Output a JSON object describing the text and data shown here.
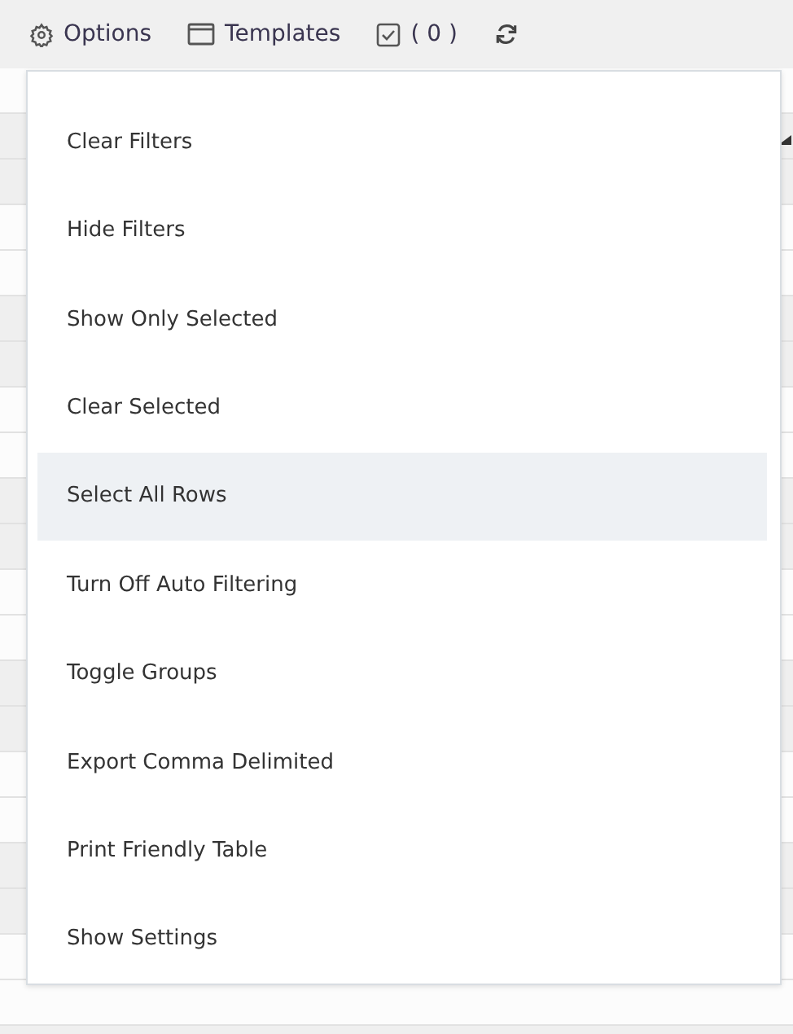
{
  "toolbar": [
    {
      "kind": "gear",
      "label": "Options"
    },
    {
      "kind": "window",
      "label": "Templates"
    },
    {
      "kind": "checkbox",
      "label": "( 0 )"
    },
    {
      "kind": "refresh"
    }
  ],
  "menu": {
    "items": [
      {
        "label": "Clear Filters",
        "selected": false
      },
      {
        "label": "Hide Filters",
        "selected": false
      },
      {
        "label": "Show Only Selected",
        "selected": false
      },
      {
        "label": "Clear Selected",
        "selected": false
      },
      {
        "label": "Select All Rows",
        "selected": true
      },
      {
        "label": "Turn Off Auto Filtering",
        "selected": false
      },
      {
        "label": "Toggle Groups",
        "selected": false
      },
      {
        "label": "Export Comma Delimited",
        "selected": false
      },
      {
        "label": "Print Friendly Table",
        "selected": false
      },
      {
        "label": "Show Settings",
        "selected": false
      }
    ]
  }
}
